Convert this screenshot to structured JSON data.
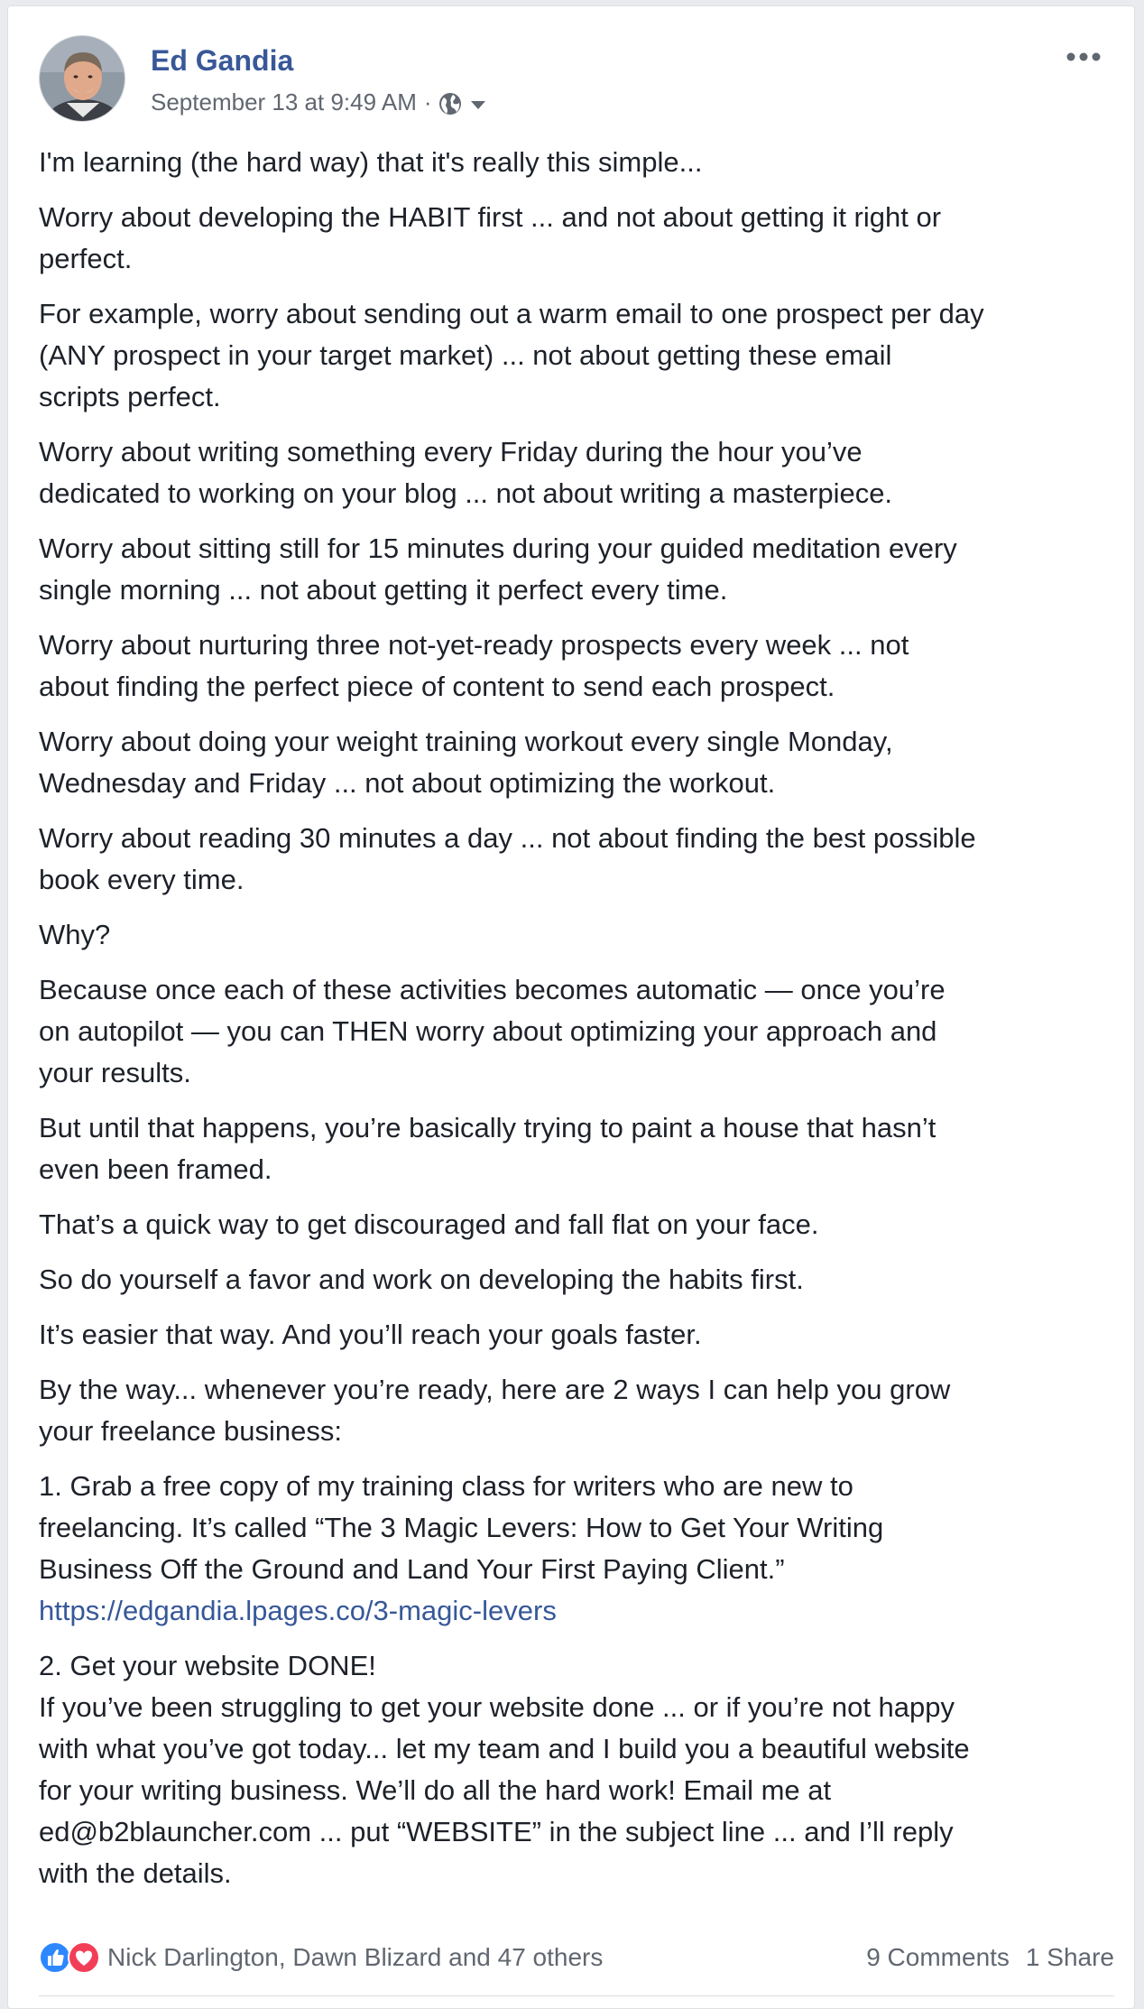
{
  "post": {
    "author": "Ed Gandia",
    "timestamp": "September 13 at 9:49 AM",
    "separator": "·",
    "privacy_icon": "globe-icon",
    "menu_icon": "more-icon"
  },
  "body": {
    "p1": "I'm learning (the hard way) that it's really this simple...",
    "p2_l1": "Worry about developing the HABIT first ... and not about getting it right or",
    "p2_l2": "perfect.",
    "p3_l1": "For example, worry about sending out a warm email to one prospect per day",
    "p3_l2": "(ANY prospect in your target market) ... not about getting these email",
    "p3_l3": "scripts perfect.",
    "p4_l1": "Worry about writing something every Friday during the hour you’ve",
    "p4_l2": "dedicated to working on your blog ... not about writing a masterpiece.",
    "p5_l1": "Worry about sitting still for 15 minutes during your guided meditation every",
    "p5_l2": "single morning ... not about getting it perfect every time.",
    "p6_l1": "Worry about nurturing three not-yet-ready prospects every week ... not",
    "p6_l2": "about finding the perfect piece of content to send each prospect.",
    "p7_l1": "Worry about doing your weight training workout every single Monday,",
    "p7_l2": "Wednesday and Friday ... not about optimizing the workout.",
    "p8_l1": "Worry about reading 30 minutes a day ... not about finding the best possible",
    "p8_l2": "book every time.",
    "p9": "Why?",
    "p10_l1": "Because once each of these activities becomes automatic — once you’re",
    "p10_l2": "on autopilot — you can THEN worry about optimizing your approach and",
    "p10_l3": "your results.",
    "p11_l1": "But until that happens, you’re basically trying to paint a house that hasn’t",
    "p11_l2": "even been framed.",
    "p12": "That’s a quick way to get discouraged and fall flat on your face.",
    "p13": "So do yourself a favor and work on developing the habits first.",
    "p14": "It’s easier that way. And you’ll reach your goals faster.",
    "p15_l1": "By the way... whenever you’re ready, here are 2 ways I can help you grow",
    "p15_l2": "your freelance business:",
    "p16_l1": "1. Grab a free copy of my training class for writers who are new to",
    "p16_l2": "freelancing. It’s called “The 3 Magic Levers: How to Get Your Writing",
    "p16_l3": "Business Off the Ground and Land Your First Paying Client.”",
    "p16_link": "https://edgandia.lpages.co/3-magic-levers",
    "p17_l1": "2. Get your website DONE!",
    "p17_l2": "If you’ve been struggling to get your website done ... or if you’re not happy",
    "p17_l3": "with what you’ve got today... let my team and I build you a beautiful website",
    "p17_l4": "for your writing business. We’ll do all the hard work! Email me at",
    "p17_l5": "ed@b2blauncher.com ... put “WEBSITE” in the subject line ... and I’ll reply",
    "p17_l6": "with the details."
  },
  "footer": {
    "reaction_icons": [
      "like-icon",
      "love-icon"
    ],
    "reactions_text": "Nick Darlington, Dawn Blizard and 47 others",
    "comments": "9 Comments",
    "shares": "1 Share"
  },
  "colors": {
    "link": "#365899",
    "author": "#385898",
    "like": "#2d88ff",
    "love": "#f33e58"
  }
}
